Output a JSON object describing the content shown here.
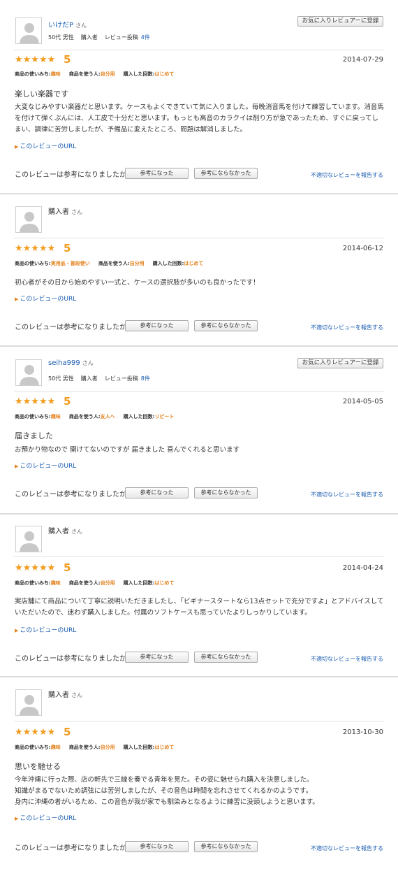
{
  "common": {
    "san": "さん",
    "stars": "★★★★★",
    "url_label": "このレビューのURL",
    "helpful_question": "このレビューは参考になりましたか？",
    "vote_yes": "参考になった",
    "vote_no": "参考にならなかった",
    "report": "不適切なレビューを報告する",
    "fav_button": "お気に入りレビュアーに登録",
    "meta_buyer": "購入者",
    "meta_posts": "レビュー投稿",
    "attr_use": "商品の使いみち:",
    "attr_who": "商品を使う人:",
    "attr_times": "購入した回数:"
  },
  "reviews": [
    {
      "reviewer": "いけだP",
      "age_gender": "50代 男性",
      "post_count": "4件",
      "score": "5",
      "date": "2014-07-29",
      "use": "趣味",
      "who": "自分用",
      "times": "はじめて",
      "title": "楽しい楽器です",
      "body": "大変なじみやすい楽器だと思います。ケースもよくできていて気に入りました。毎晩消音馬を付けて練習しています。消音馬を付けて弾くぶんには、人工皮で十分だと思います。もっとも高音のカラクイは削り方が急であったため、すぐに戻ってしまい、調律に苦労しましたが、予備品に変えたところ、問題は解消しました。"
    },
    {
      "reviewer": "購入者",
      "score": "5",
      "date": "2014-06-12",
      "use": "実用品・普段使い",
      "who": "自分用",
      "times": "はじめて",
      "title": "",
      "body": "初心者がその日から始めやすい一式と、ケースの選択肢が多いのも良かったです！"
    },
    {
      "reviewer": "seiha999",
      "age_gender": "50代 男性",
      "post_count": "8件",
      "score": "5",
      "date": "2014-05-05",
      "use": "趣味",
      "who": "友人へ",
      "times": "リピート",
      "title": "届きました",
      "body": "お預かり物なので 開けてないのですが 届きました 喜んでくれると思います"
    },
    {
      "reviewer": "購入者",
      "score": "5",
      "date": "2014-04-24",
      "use": "趣味",
      "who": "自分用",
      "times": "はじめて",
      "title": "",
      "body": "実店舗にて商品について丁寧に説明いただきましたし、「ビギナースタートなら13点セットで充分ですよ」とアドバイスしていただいたので、迷わず購入しました。付属のソフトケースも思っていたよりしっかりしています。"
    },
    {
      "reviewer": "購入者",
      "score": "5",
      "date": "2013-10-30",
      "use": "趣味",
      "who": "自分用",
      "times": "はじめて",
      "title": "思いを馳せる",
      "body": "今年沖縄に行った際、店の軒先で三線を奏でる青年を見た。その姿に魅せられ購入を決意しました。\n知識がまるでないため調弦には苦労しましたが、その音色は時間を忘れさせてくれるかのようです。\n身内に沖縄の者がいるため、この音色が我が家でも馴染みとなるように練習に没頭しようと思います。"
    }
  ]
}
